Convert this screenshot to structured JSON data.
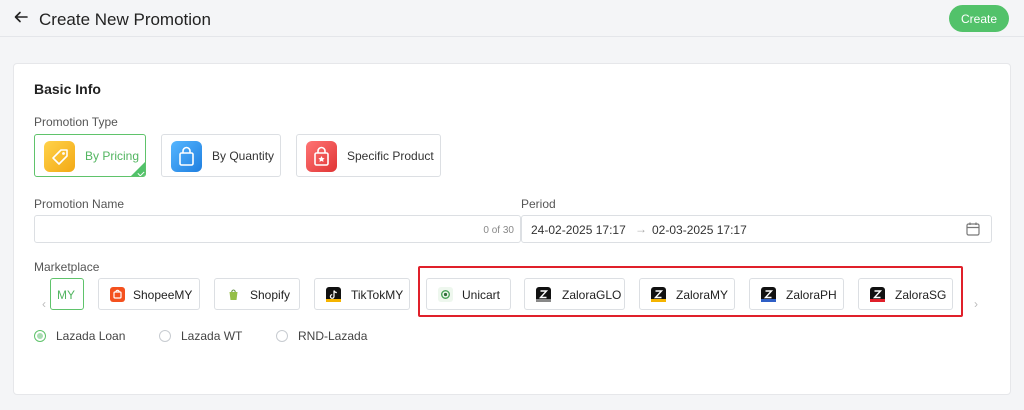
{
  "header": {
    "title": "Create New Promotion",
    "create_label": "Create"
  },
  "basic_info": {
    "title": "Basic Info",
    "promotion_type_label": "Promotion Type",
    "types": [
      {
        "label": "By Pricing",
        "selected": true
      },
      {
        "label": "By Quantity",
        "selected": false
      },
      {
        "label": "Specific Product",
        "selected": false
      }
    ],
    "name_label": "Promotion Name",
    "name_value": "",
    "name_counter": "0 of 30",
    "period_label": "Period",
    "period_start": "24-02-2025 17:17",
    "period_separator": "→",
    "period_end": "02-03-2025 17:17",
    "marketplace_label": "Marketplace",
    "marketplaces": [
      {
        "label": "MY",
        "active": true
      },
      {
        "label": "ShopeeMY"
      },
      {
        "label": "Shopify"
      },
      {
        "label": "TikTokMY"
      },
      {
        "label": "Unicart"
      },
      {
        "label": "ZaloraGLO"
      },
      {
        "label": "ZaloraMY"
      },
      {
        "label": "ZaloraPH"
      },
      {
        "label": "ZaloraSG"
      }
    ],
    "stores": [
      {
        "label": "Lazada Loan",
        "checked": true
      },
      {
        "label": "Lazada WT",
        "checked": false
      },
      {
        "label": "RND-Lazada",
        "checked": false
      }
    ]
  },
  "colors": {
    "accent_green": "#52c26a",
    "highlight_red": "#e0202a",
    "pricing_icon": "#f6b51e",
    "quantity_icon": "#2f8fe8",
    "specific_icon": "#ec4646"
  },
  "icons": {
    "back": "arrow-left-icon",
    "calendar": "calendar-icon",
    "prev": "chevron-left-icon",
    "next": "chevron-right-icon"
  }
}
